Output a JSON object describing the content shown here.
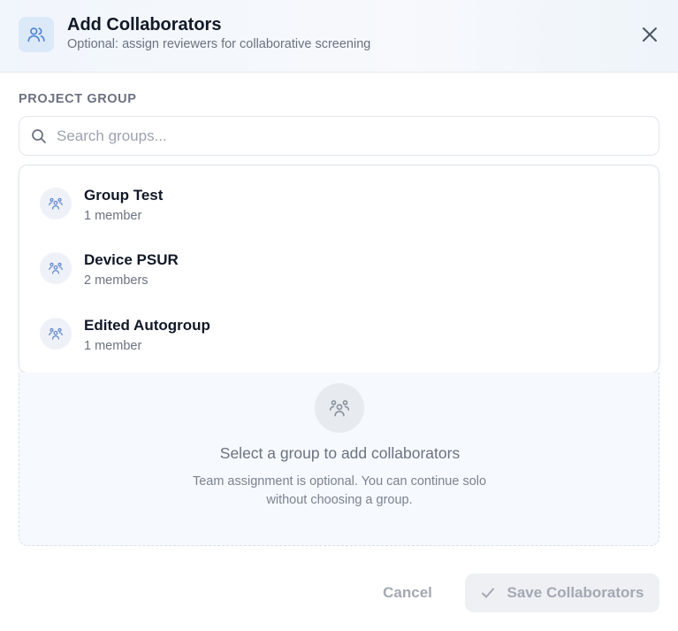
{
  "dialog": {
    "title": "Add Collaborators",
    "subtitle": "Optional: assign reviewers for collaborative screening",
    "header_icon": "users-icon",
    "close_icon": "close-icon"
  },
  "project_group": {
    "label": "PROJECT GROUP",
    "search": {
      "placeholder": "Search groups...",
      "value": "",
      "icon": "search-icon"
    }
  },
  "groups": [
    {
      "name": "Group Test",
      "members": "1 member",
      "icon": "group-icon"
    },
    {
      "name": "Device PSUR",
      "members": "2 members",
      "icon": "group-icon"
    },
    {
      "name": "Edited Autogroup",
      "members": "1 member",
      "icon": "group-icon"
    }
  ],
  "empty_state": {
    "icon": "group-icon",
    "title": "Select a group to add collaborators",
    "description": "Team assignment is optional. You can continue solo without choosing a group."
  },
  "footer": {
    "cancel_label": "Cancel",
    "save_label": "Save Collaborators",
    "save_icon": "check-icon"
  },
  "colors": {
    "accent": "#4a7fd6",
    "header_bg": "#f1f6fc",
    "muted_text": "#6b7280",
    "disabled_text": "#a3a9b3"
  }
}
